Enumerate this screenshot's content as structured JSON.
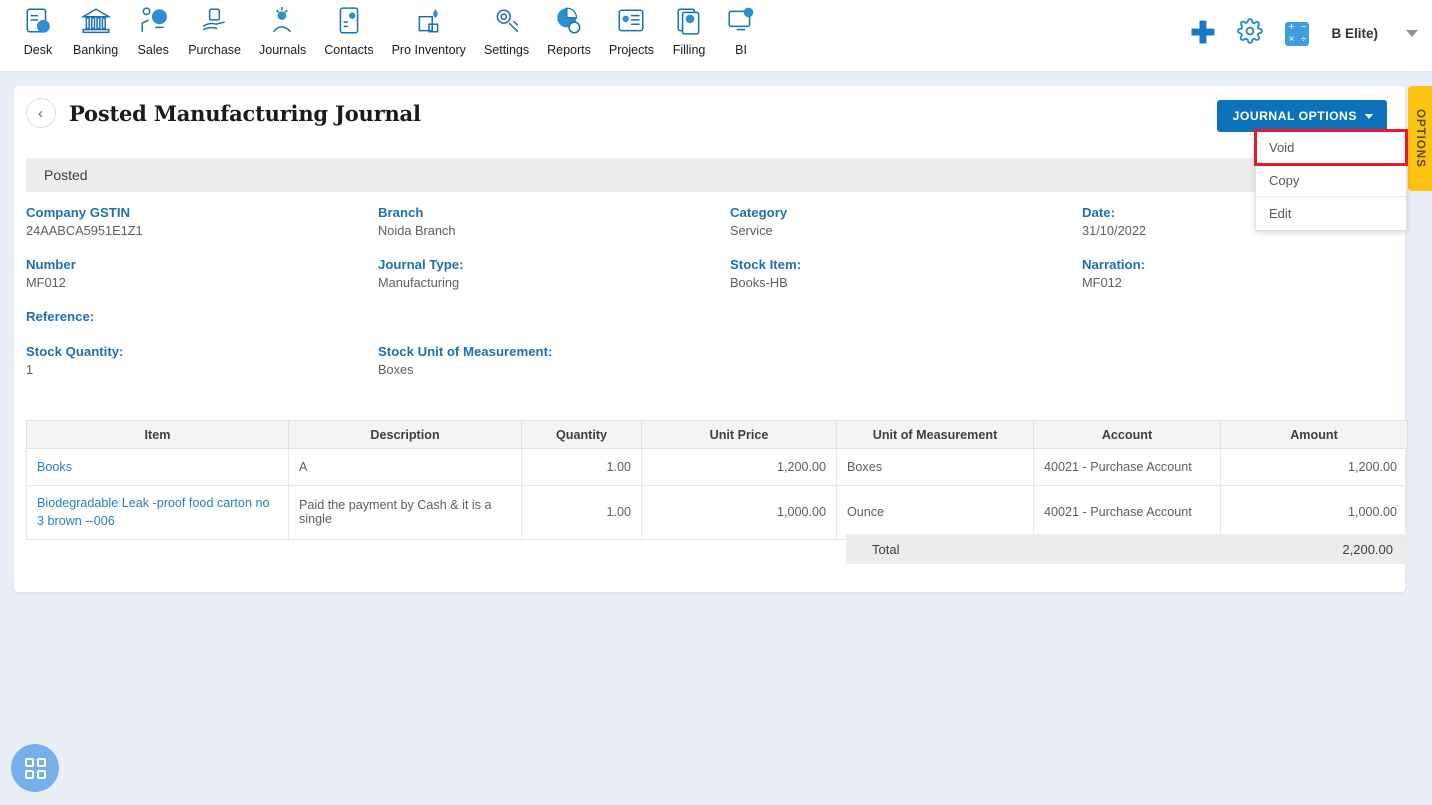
{
  "topnav": {
    "items": [
      {
        "label": "Desk",
        "icon": "dashboard-icon"
      },
      {
        "label": "Banking",
        "icon": "bank-icon"
      },
      {
        "label": "Sales",
        "icon": "sales-icon"
      },
      {
        "label": "Purchase",
        "icon": "purchase-icon"
      },
      {
        "label": "Journals",
        "icon": "journals-icon"
      },
      {
        "label": "Contacts",
        "icon": "contacts-icon"
      },
      {
        "label": "Pro Inventory",
        "icon": "inventory-icon"
      },
      {
        "label": "Settings",
        "icon": "settings-icon"
      },
      {
        "label": "Reports",
        "icon": "reports-icon"
      },
      {
        "label": "Projects",
        "icon": "projects-icon"
      },
      {
        "label": "Filling",
        "icon": "filling-icon"
      },
      {
        "label": "BI",
        "icon": "bi-icon"
      }
    ],
    "add_icon": "plus-icon",
    "settings_icon": "gear-icon",
    "calculator_icon": "calculator-icon",
    "calculator_symbols": [
      "+",
      "−",
      "×",
      "÷"
    ],
    "user_label": "B Elite)",
    "user_caret": "chevron-down-icon"
  },
  "page": {
    "back_icon": "chevron-left-icon",
    "title": "Posted Manufacturing Journal",
    "status": "Posted"
  },
  "journal_options": {
    "button_label": "JOURNAL OPTIONS",
    "items": [
      {
        "label": "Void",
        "highlighted": true
      },
      {
        "label": "Copy",
        "highlighted": false
      },
      {
        "label": "Edit",
        "highlighted": false
      }
    ]
  },
  "options_tab": {
    "label": "OPTIONS"
  },
  "details": [
    [
      {
        "label": "Company GSTIN",
        "value": "24AABCA5951E1Z1"
      },
      {
        "label": "Branch",
        "value": "Noida Branch"
      },
      {
        "label": "Category",
        "value": "Service"
      },
      {
        "label": "Date:",
        "value": "31/10/2022"
      }
    ],
    [
      {
        "label": "Number",
        "value": "MF012"
      },
      {
        "label": "Journal Type:",
        "value": "Manufacturing"
      },
      {
        "label": "Stock Item:",
        "value": "Books-HB"
      },
      {
        "label": "Narration:",
        "value": "MF012"
      }
    ],
    [
      {
        "label": "Reference:",
        "value": ""
      }
    ],
    [
      {
        "label": "Stock Quantity:",
        "value": "1"
      },
      {
        "label": "Stock Unit of Measurement:",
        "value": "Boxes"
      }
    ]
  ],
  "table": {
    "columns": [
      "Item",
      "Description",
      "Quantity",
      "Unit Price",
      "Unit of Measurement",
      "Account",
      "Amount"
    ],
    "rows": [
      {
        "item": "Books",
        "description": "A",
        "quantity": "1.00",
        "unit_price": "1,200.00",
        "uom": "Boxes",
        "account": "40021 - Purchase Account",
        "amount": "1,200.00"
      },
      {
        "item": "Biodegradable Leak -proof food carton no 3 brown --006",
        "description": "Paid the payment by Cash & it is a single",
        "quantity": "1.00",
        "unit_price": "1,000.00",
        "uom": "Ounce",
        "account": "40021 - Purchase Account",
        "amount": "1,000.00"
      }
    ],
    "total_label": "Total",
    "total_value": "2,200.00"
  },
  "fab": {
    "icon": "grid-apps-icon"
  },
  "colors": {
    "accent_blue": "#0e72bb",
    "label_blue": "#1f6fb2",
    "link_blue": "#2a7fc0",
    "highlight_red": "#e8192c",
    "options_yellow": "#fdc313",
    "page_bg": "#e9eef8",
    "status_gray": "#ededed"
  }
}
